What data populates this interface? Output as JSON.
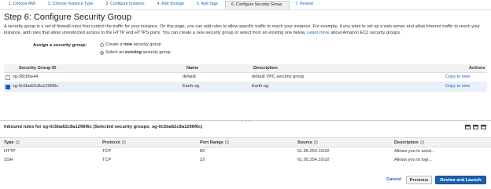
{
  "wizard": {
    "steps": [
      {
        "label": "1. Choose AMI"
      },
      {
        "label": "2. Choose Instance Type"
      },
      {
        "label": "3. Configure Instance"
      },
      {
        "label": "4. Add Storage"
      },
      {
        "label": "5. Add Tags"
      },
      {
        "label": "6. Configure Security Group"
      },
      {
        "label": "7. Review"
      }
    ]
  },
  "page": {
    "title": "Step 6: Configure Security Group",
    "description": "A security group is a set of firewall rules that control the traffic for your instance. On this page, you can add rules to allow specific traffic to reach your instance. For example, if you want to set up a web server and allow Internet traffic to reach your instance, add rules that allow unrestricted access to the HTTP and HTTPS ports. You can create a new security group or select from an existing one below.",
    "learn_more": "Learn more",
    "description_tail": "about Amazon EC2 security groups."
  },
  "assign": {
    "label": "Assign a security group:",
    "option_new_pre": "Create a",
    "option_new_bold": "new",
    "option_new_post": "security group",
    "option_existing_pre": "Select an",
    "option_existing_bold": "existing",
    "option_existing_post": "security group",
    "selected": "existing"
  },
  "sg_table": {
    "headers": {
      "id": "Security Group ID",
      "name": "Name",
      "description": "Description",
      "actions": "Actions"
    },
    "rows": [
      {
        "id": "sg-38cb5e44",
        "name": "default",
        "description": "default VPC security group",
        "action": "Copy to new",
        "checked": false
      },
      {
        "id": "sg-0c5ba62c8a1296f6c",
        "name": "Earth-sg",
        "description": "Earth-sg",
        "action": "Copy to new",
        "checked": true
      }
    ]
  },
  "inbound": {
    "title": "Inbound rules for sg-0c5ba62c8a1296f6c (Selected security groups: sg-0c5ba62c8a1296f6c)",
    "headers": {
      "type": "Type",
      "protocol": "Protocol",
      "port_range": "Port Range",
      "source": "Source",
      "description": "Description"
    },
    "rows": [
      {
        "type": "HTTP",
        "protocol": "TCP",
        "port_range": "80",
        "source": "61.95.254.10/32",
        "description": "Allows you to send..."
      },
      {
        "type": "SSH",
        "protocol": "TCP",
        "port_range": "22",
        "source": "61.95.254.10/32",
        "description": "Allows you to logi..."
      }
    ]
  },
  "footer": {
    "cancel": "Cancel",
    "previous": "Previous",
    "review_launch": "Review and Launch"
  },
  "colors": {
    "accent": "#1f5fb0",
    "link": "#1166bb"
  }
}
